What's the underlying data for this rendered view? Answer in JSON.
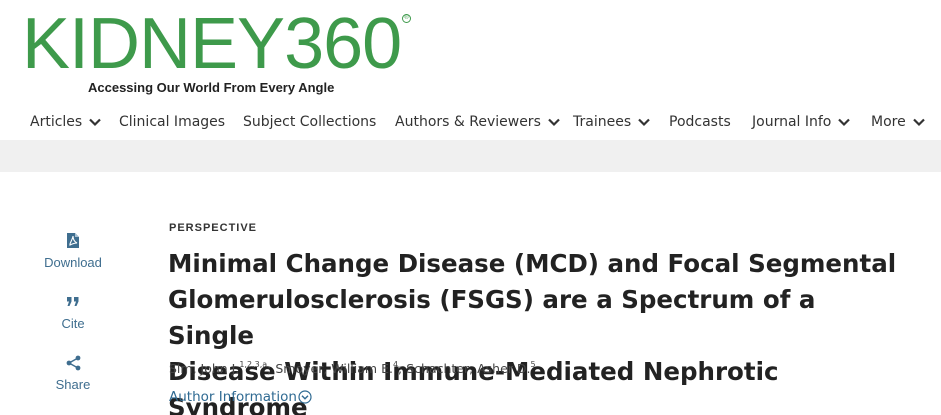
{
  "header": {
    "logo_text": "KIDNEY360",
    "logo_reg": "®",
    "tagline": "Accessing Our World From Every Angle"
  },
  "nav": {
    "items": [
      {
        "label": "Articles",
        "dropdown": true
      },
      {
        "label": "Clinical Images",
        "dropdown": false
      },
      {
        "label": "Subject Collections",
        "dropdown": false
      },
      {
        "label": "Authors & Reviewers",
        "dropdown": true
      },
      {
        "label": "Trainees",
        "dropdown": true
      },
      {
        "label": "Podcasts",
        "dropdown": false
      },
      {
        "label": "Journal Info",
        "dropdown": true
      },
      {
        "label": "More",
        "dropdown": true
      }
    ]
  },
  "sidebar": {
    "download": {
      "label": "Download",
      "icon": "pdf-download-icon"
    },
    "cite": {
      "label": "Cite",
      "icon": "quote-icon"
    },
    "share": {
      "label": "Share",
      "icon": "share-icon"
    }
  },
  "article": {
    "type": "PERSPECTIVE",
    "title_lines": [
      "Minimal Change Disease (MCD) and Focal Segmental",
      "Glomerulosclerosis (FSGS) are a Spectrum of a Single",
      "Disease Within Immune-Mediated Nephrotic Syndrome"
    ],
    "authors": [
      {
        "name": "Sim, John J.",
        "sup": "1,2,3,a",
        "sep": "; "
      },
      {
        "name": "Smoyer, William E.",
        "sup": "4",
        "sep": "; "
      },
      {
        "name": "Schachter, Asher D.",
        "sup": "5",
        "sep": ""
      }
    ],
    "author_info_label": "Author Information"
  },
  "colors": {
    "brand_green": "#3e9a4b",
    "link_blue": "#2f6a92",
    "band_gray": "#f0f0f0"
  }
}
